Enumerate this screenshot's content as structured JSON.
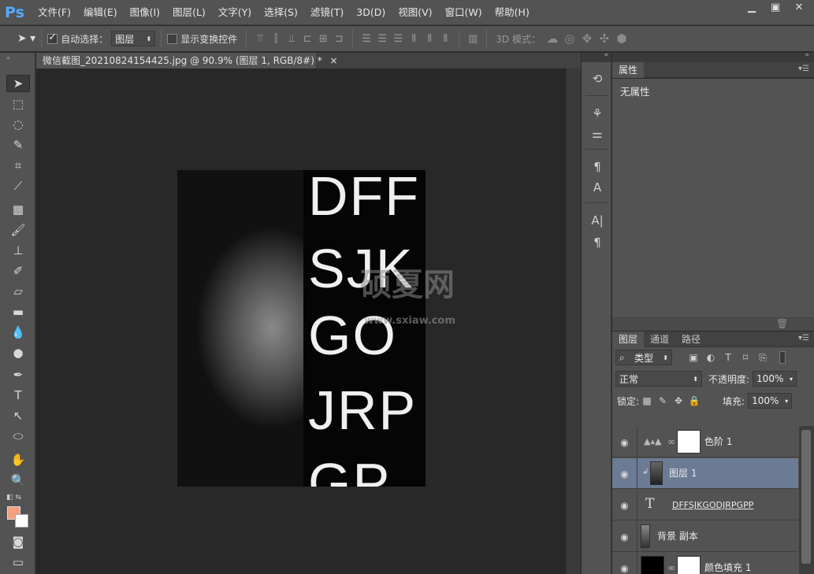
{
  "app": {
    "logo": "Ps",
    "menu": [
      "文件(F)",
      "编辑(E)",
      "图像(I)",
      "图层(L)",
      "文字(Y)",
      "选择(S)",
      "滤镜(T)",
      "3D(D)",
      "视图(V)",
      "窗口(W)",
      "帮助(H)"
    ],
    "window_controls": [
      "minimize-icon",
      "maximize-icon",
      "close-icon"
    ]
  },
  "options": {
    "auto_select_label": "自动选择：",
    "auto_select_checked": true,
    "auto_select_target": "图层",
    "show_transform_label": "显示变换控件",
    "show_transform_checked": false,
    "mode_3d_label": "3D 模式："
  },
  "document": {
    "tab_title": "微信截图_20210824154425.jpg @ 90.9% (图层 1, RGB/8#) *",
    "letters": [
      "DFF",
      "SJK",
      "GO",
      "JRP",
      "GP"
    ],
    "watermark_text": "硕夏网",
    "watermark_url": "www.sxiaw.com"
  },
  "tools": {
    "fg_color": "#f5a080",
    "bg_color": "#ffffff"
  },
  "properties_panel": {
    "tab_label": "属性",
    "empty_text": "无属性"
  },
  "layers_panel": {
    "tabs": [
      "图层",
      "通道",
      "路径"
    ],
    "filter_label": "类型",
    "blend_mode": "正常",
    "opacity_label": "不透明度:",
    "opacity_value": "100%",
    "lock_label": "锁定:",
    "fill_label": "填充:",
    "fill_value": "100%",
    "layers": [
      {
        "name": "色阶 1",
        "type": "adjustment",
        "selected": false
      },
      {
        "name": "图层 1",
        "type": "image",
        "selected": true
      },
      {
        "name": "DFFSJKGODJRPGPP",
        "type": "text",
        "selected": false
      },
      {
        "name": "背景 副本",
        "type": "image",
        "selected": false
      },
      {
        "name": "颜色填充 1",
        "type": "fill",
        "selected": false
      }
    ]
  }
}
